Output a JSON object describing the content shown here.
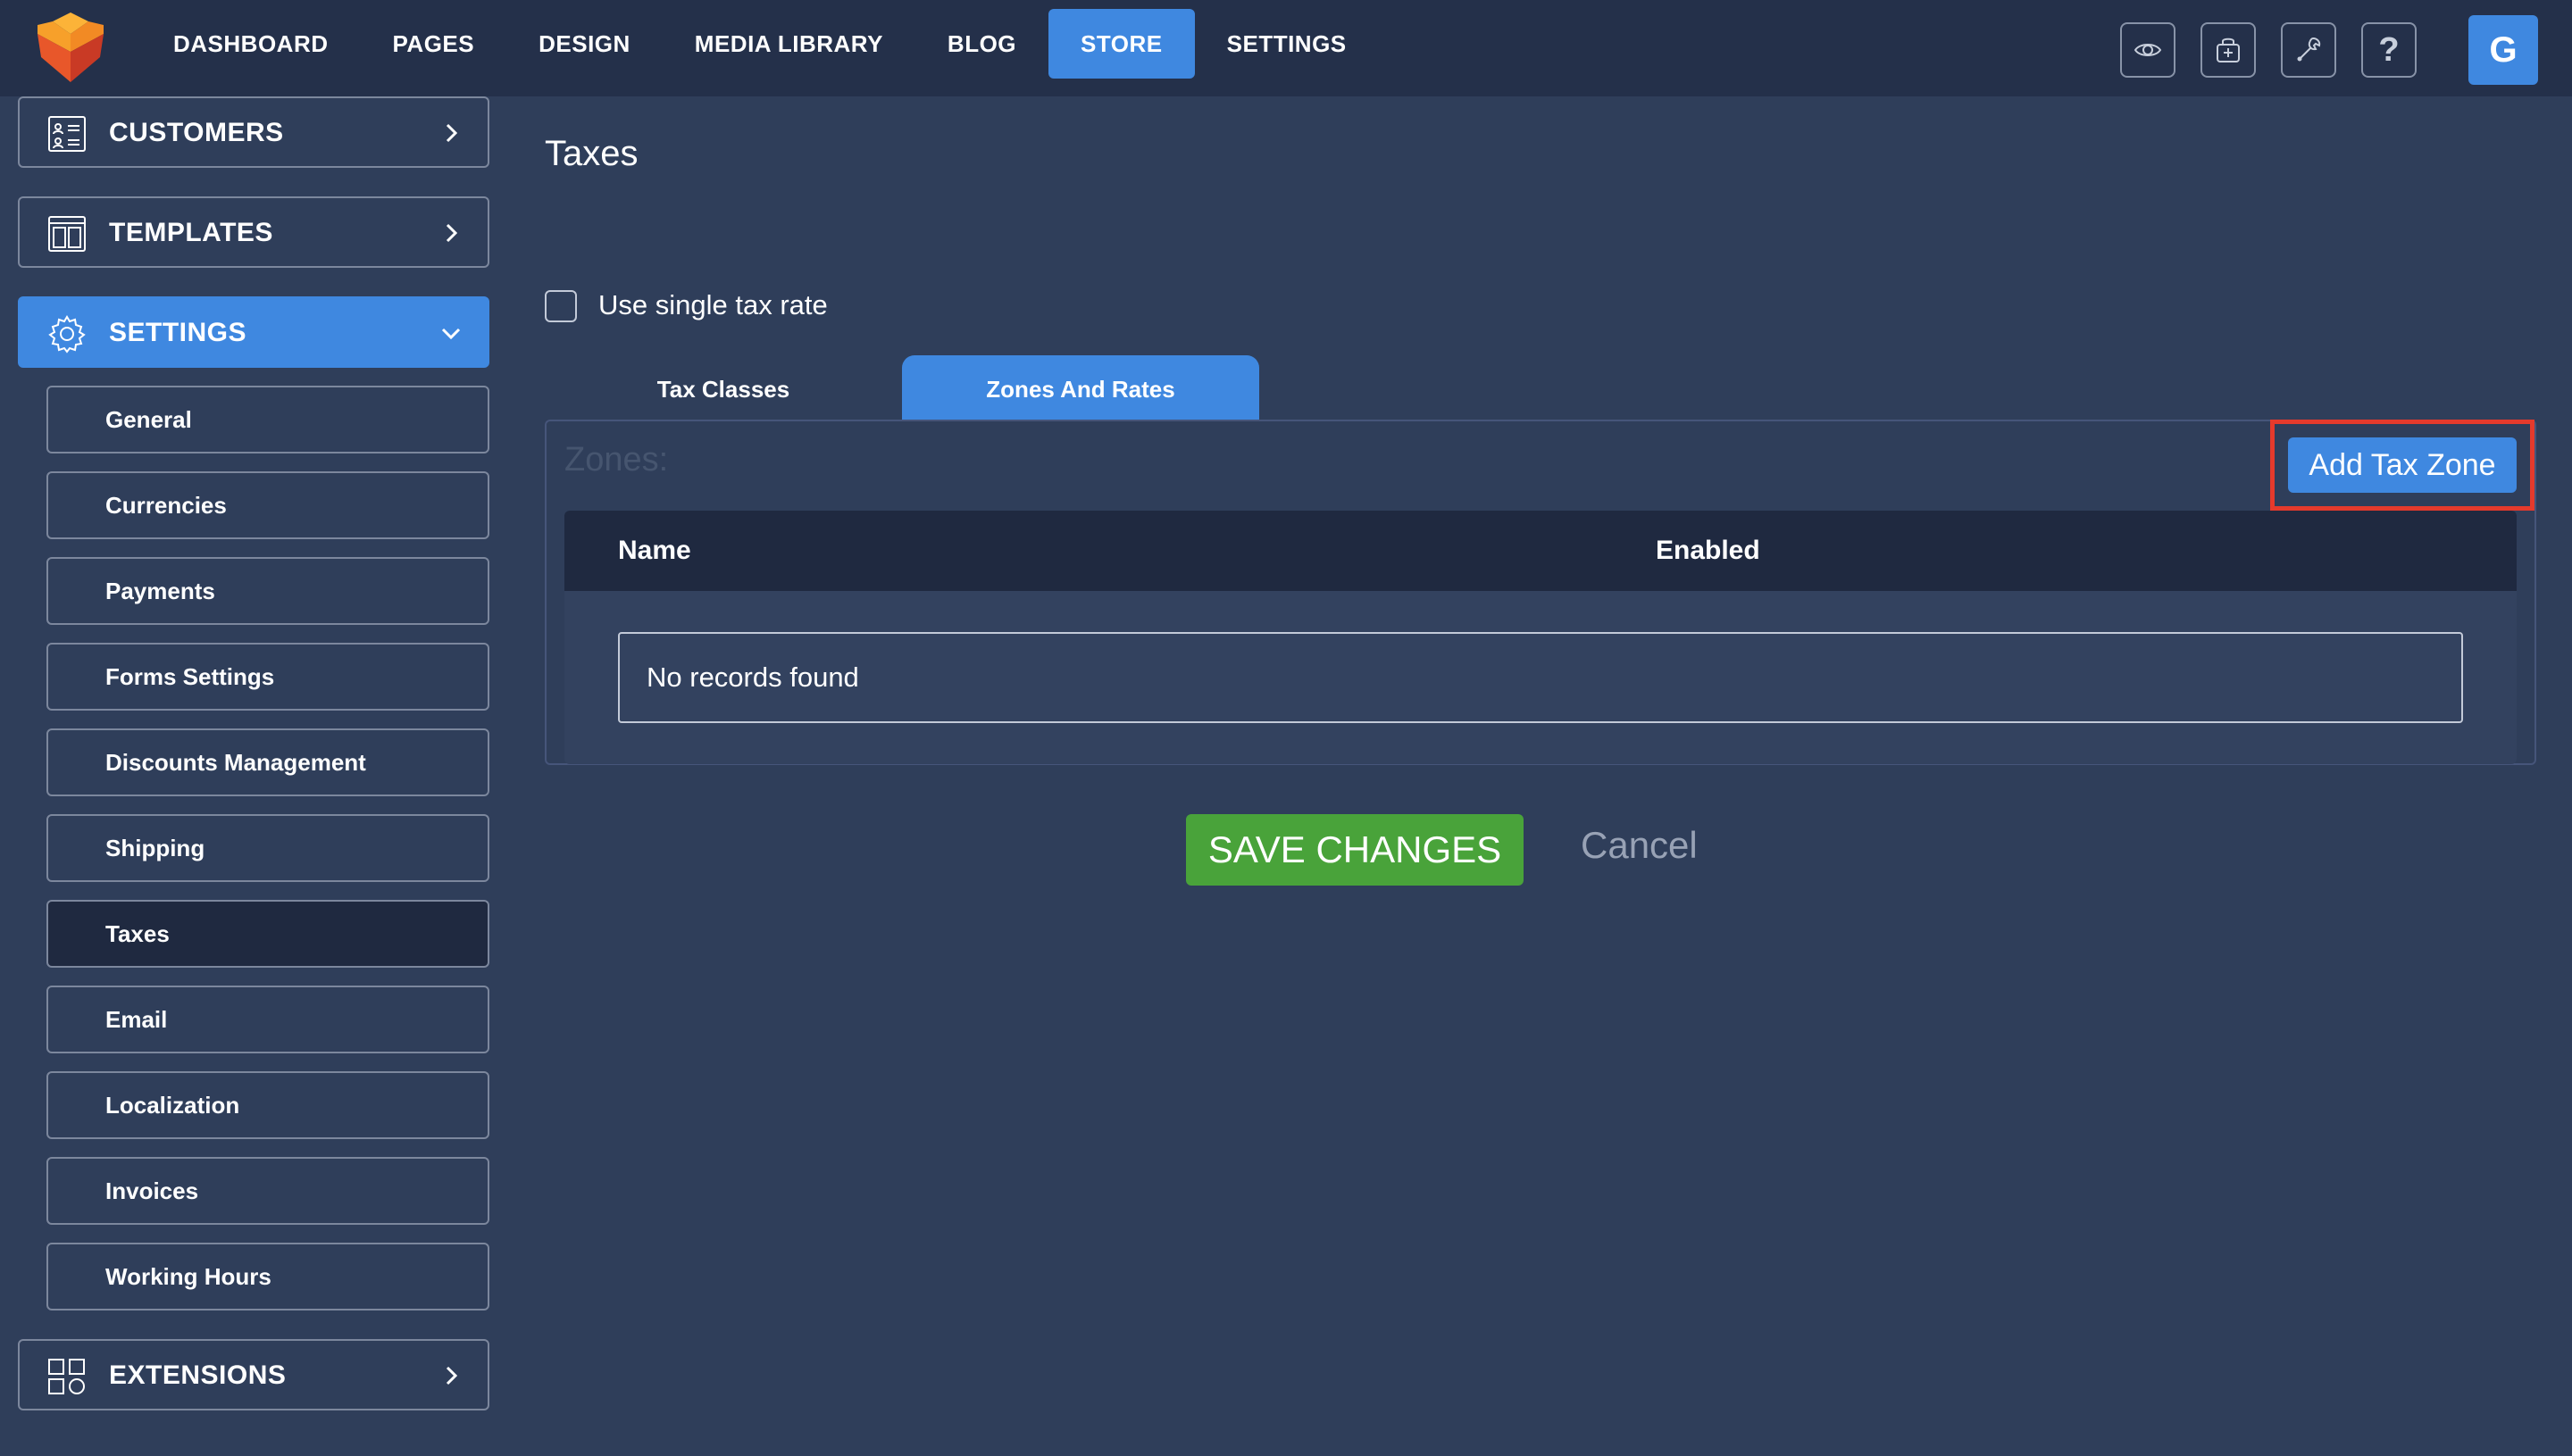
{
  "colors": {
    "background": "#2f3e5a",
    "topbar": "#24304a",
    "accent": "#3f88e0",
    "save": "#49a33a",
    "highlight": "#e53a2c"
  },
  "nav": {
    "items": [
      {
        "label": "DASHBOARD"
      },
      {
        "label": "PAGES"
      },
      {
        "label": "DESIGN"
      },
      {
        "label": "MEDIA LIBRARY"
      },
      {
        "label": "BLOG"
      },
      {
        "label": "STORE",
        "active": true
      },
      {
        "label": "SETTINGS"
      }
    ],
    "tools": [
      "eye-icon",
      "shop-icon",
      "wrench-icon",
      "help-icon"
    ],
    "help_glyph": "?",
    "avatar": "G"
  },
  "sidebar": {
    "customers": {
      "label": "CUSTOMERS",
      "icon": "customers-icon"
    },
    "templates": {
      "label": "TEMPLATES",
      "icon": "templates-icon"
    },
    "settings": {
      "label": "SETTINGS",
      "icon": "gear-icon"
    },
    "extensions": {
      "label": "EXTENSIONS",
      "icon": "extensions-icon"
    },
    "items": [
      {
        "label": "General"
      },
      {
        "label": "Currencies"
      },
      {
        "label": "Payments"
      },
      {
        "label": "Forms Settings"
      },
      {
        "label": "Discounts Management"
      },
      {
        "label": "Shipping"
      },
      {
        "label": "Taxes",
        "active": true
      },
      {
        "label": "Email"
      },
      {
        "label": "Localization"
      },
      {
        "label": "Invoices"
      },
      {
        "label": "Working Hours"
      }
    ]
  },
  "main": {
    "title": "Taxes",
    "single_rate_label": "Use single tax rate",
    "single_rate_checked": false,
    "tabs": [
      {
        "label": "Tax Classes"
      },
      {
        "label": "Zones And Rates",
        "active": true
      }
    ],
    "zones_label": "Zones:",
    "add_button": "Add Tax Zone",
    "table": {
      "columns": [
        "Name",
        "Enabled"
      ],
      "empty_text": "No records found"
    },
    "save_button": "SAVE CHANGES",
    "cancel": "Cancel"
  }
}
